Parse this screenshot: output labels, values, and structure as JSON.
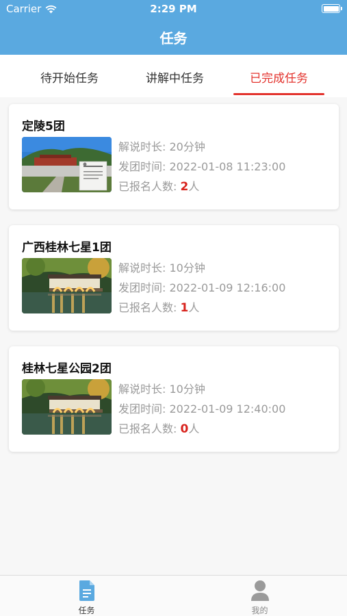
{
  "status_bar": {
    "carrier": "Carrier",
    "time": "2:29 PM"
  },
  "nav": {
    "title": "任务"
  },
  "tabs": [
    {
      "label": "待开始任务",
      "active": false
    },
    {
      "label": "讲解中任务",
      "active": false
    },
    {
      "label": "已完成任务",
      "active": true
    }
  ],
  "tasks": [
    {
      "title": "定陵5团",
      "duration": "解说时长: 20分钟",
      "depart_time": "发团时间: 2022-01-08 11:23:00",
      "signup_label": "已报名人数:",
      "signup_count": "2",
      "signup_unit": "人",
      "image": "mausoleum-photo"
    },
    {
      "title": "广西桂林七星1团",
      "duration": "解说时长: 10分钟",
      "depart_time": "发团时间: 2022-01-09 12:16:00",
      "signup_label": "已报名人数:",
      "signup_count": "1",
      "signup_unit": "人",
      "image": "bridge-photo"
    },
    {
      "title": "桂林七星公园2团",
      "duration": "解说时长: 10分钟",
      "depart_time": "发团时间: 2022-01-09 12:40:00",
      "signup_label": "已报名人数:",
      "signup_count": "0",
      "signup_unit": "人",
      "image": "bridge-photo"
    }
  ],
  "tabbar": {
    "items": [
      {
        "label": "任务",
        "icon": "document-icon",
        "active": true
      },
      {
        "label": "我的",
        "icon": "person-icon",
        "active": false
      }
    ]
  },
  "colors": {
    "header": "#5aa9e0",
    "accent": "#e3322c",
    "count": "#d8231d"
  }
}
